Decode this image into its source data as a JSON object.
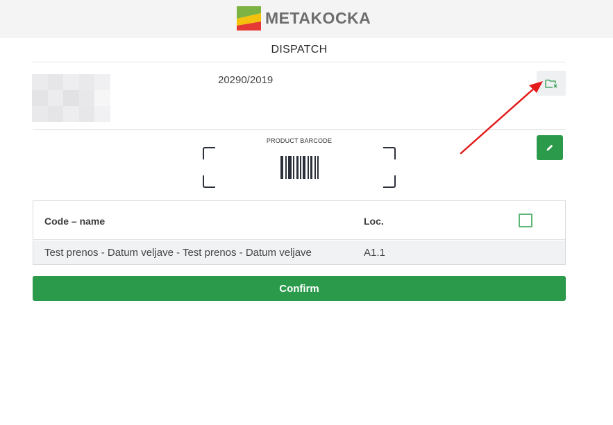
{
  "header": {
    "brand": "METAKOCKA",
    "logo_colors": [
      "#7cb342",
      "#f4c20d",
      "#e53935"
    ]
  },
  "page": {
    "title": "DISPATCH",
    "document_number": "20290/2019"
  },
  "actions": {
    "folder_icon": "folder-export-icon",
    "edit_icon": "pencil-icon"
  },
  "scanner": {
    "label": "PRODUCT BARCODE",
    "icon": "barcode-icon"
  },
  "table": {
    "headers": {
      "code_name": "Code – name",
      "location": "Loc."
    },
    "rows": [
      {
        "code_name": "Test prenos - Datum veljave - Test prenos - Datum veljave",
        "location": "A1.1"
      }
    ]
  },
  "footer": {
    "confirm_label": "Confirm"
  },
  "colors": {
    "primary_green": "#2b9a4b",
    "annotation_arrow": "#e31b1b"
  }
}
